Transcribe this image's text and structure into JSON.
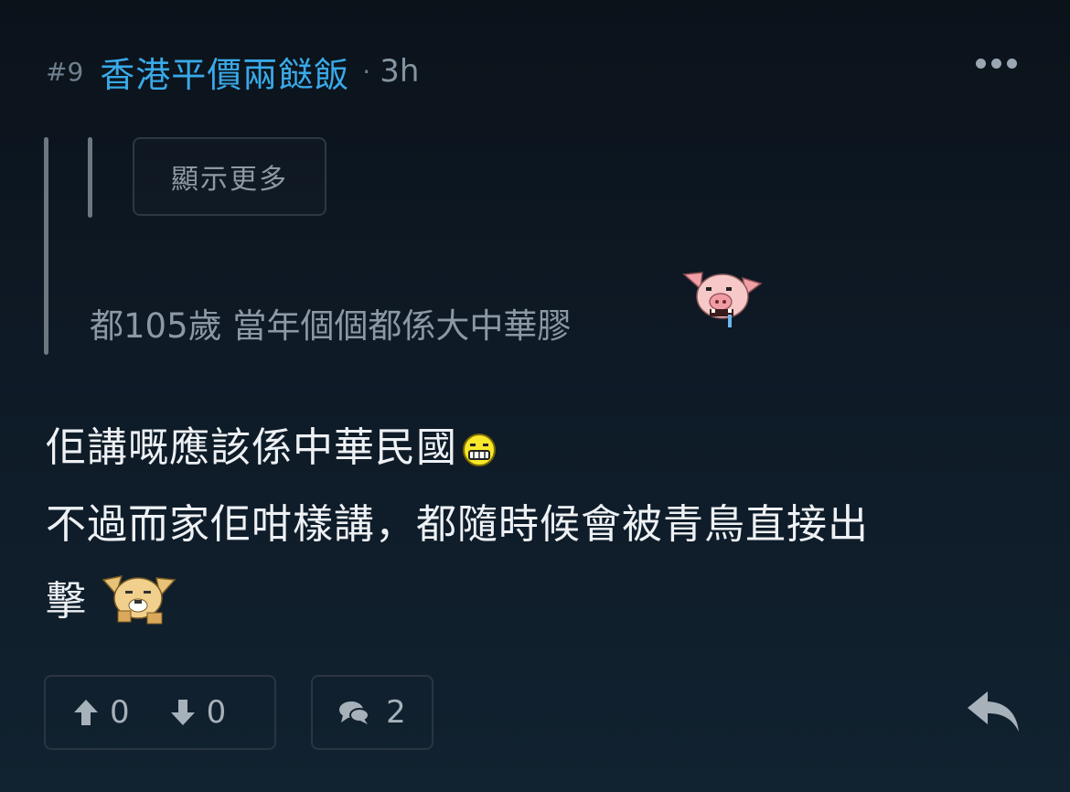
{
  "post": {
    "number": "#9",
    "username": "香港平價兩餸飯",
    "separator": "·",
    "time": "3h"
  },
  "icons": {
    "more": "more-options-icon",
    "pig": "pig-emoji-icon",
    "laugh": "laughing-emoji-icon",
    "dog": "dog-emoji-icon",
    "upvote": "arrow-up-icon",
    "downvote": "arrow-down-icon",
    "comments": "comment-bubbles-icon",
    "reply": "reply-arrow-icon"
  },
  "quote": {
    "show_more_label": "顯示更多",
    "text": "都105歲 當年個個都係大中華膠"
  },
  "content": {
    "line1": "佢講嘅應該係中華民國",
    "line2": "不過而家佢咁樣講，都隨時候會被青鳥直接出",
    "line3": "擊"
  },
  "footer": {
    "upvotes": "0",
    "downvotes": "0",
    "comments": "2"
  },
  "colors": {
    "username": "#39a9e8",
    "background": "#0e1a26"
  }
}
